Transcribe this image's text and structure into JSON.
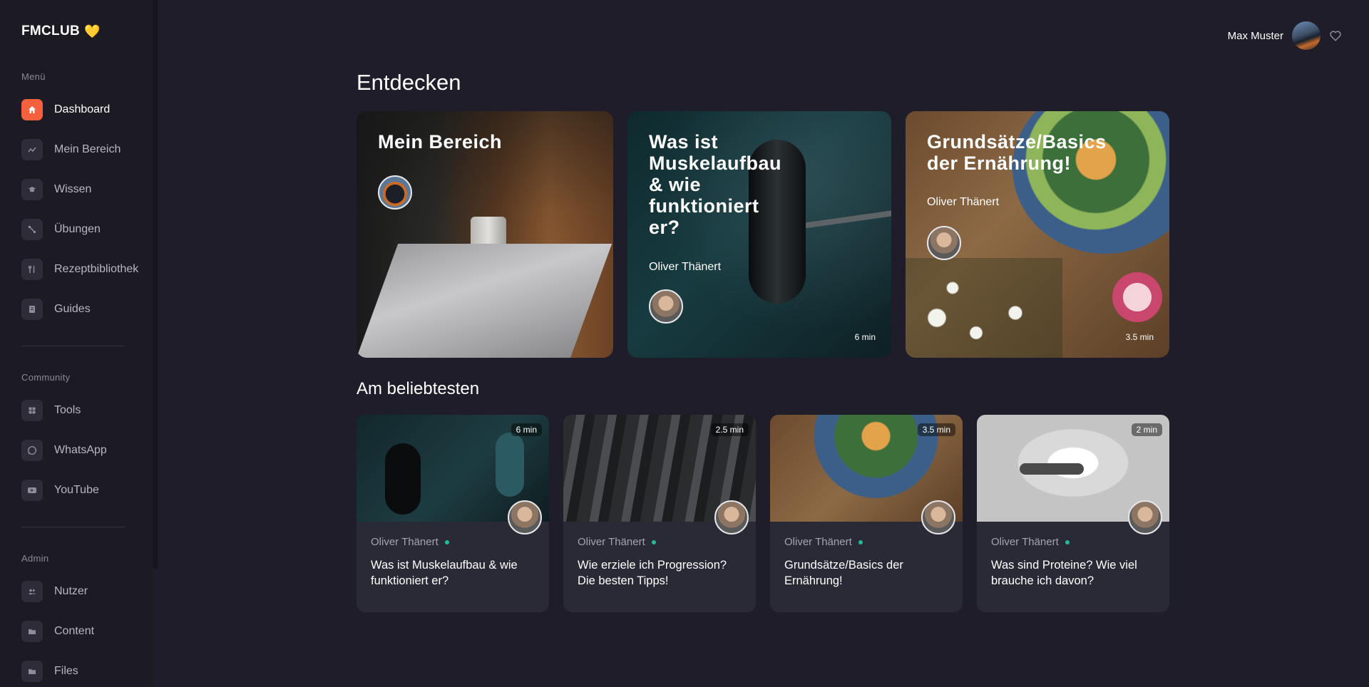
{
  "brand": {
    "name": "FMCLUB",
    "emoji": "💛"
  },
  "sidebar": {
    "menu_label": "Menü",
    "menu_items": [
      {
        "label": "Dashboard",
        "icon": "home-icon",
        "active": true
      },
      {
        "label": "Mein Bereich",
        "icon": "activity-icon"
      },
      {
        "label": "Wissen",
        "icon": "graduation-cap-icon"
      },
      {
        "label": "Übungen",
        "icon": "dumbbell-icon"
      },
      {
        "label": "Rezeptbibliothek",
        "icon": "utensils-icon"
      },
      {
        "label": "Guides",
        "icon": "book-icon"
      }
    ],
    "community_label": "Community",
    "community_items": [
      {
        "label": "Tools",
        "icon": "grid-icon"
      },
      {
        "label": "WhatsApp",
        "icon": "whatsapp-icon"
      },
      {
        "label": "YouTube",
        "icon": "youtube-icon"
      }
    ],
    "admin_label": "Admin",
    "admin_items": [
      {
        "label": "Nutzer",
        "icon": "users-icon"
      },
      {
        "label": "Content",
        "icon": "folder-icon"
      },
      {
        "label": "Files",
        "icon": "folder-icon"
      }
    ]
  },
  "header": {
    "user_name": "Max Muster"
  },
  "main": {
    "title": "Entdecken",
    "hero_cards": [
      {
        "title": "Mein Bereich"
      },
      {
        "title": "Was ist Muskelaufbau & wie funktioniert er?",
        "author": "Oliver Thänert",
        "duration": "6 min"
      },
      {
        "title": "Grundsätze/Basics der Ernährung!",
        "author": "Oliver Thänert",
        "duration": "3.5 min"
      }
    ],
    "popular_title": "Am beliebtesten",
    "popular_cards": [
      {
        "duration": "6 min",
        "author": "Oliver Thänert",
        "title": "Was ist Muskelaufbau & wie funktioniert er?"
      },
      {
        "duration": "2.5 min",
        "author": "Oliver Thänert",
        "title": "Wie erziele ich Progression? Die besten Tipps!"
      },
      {
        "duration": "3.5 min",
        "author": "Oliver Thänert",
        "title": "Grundsätze/Basics der Ernährung!"
      },
      {
        "duration": "2 min",
        "author": "Oliver Thänert",
        "title": "Was sind Proteine? Wie viel brauche ich davon?"
      }
    ]
  },
  "colors": {
    "accent": "#f4613f",
    "background": "#1f1d29",
    "card": "#2a2936",
    "status_dot": "#23b99a"
  }
}
